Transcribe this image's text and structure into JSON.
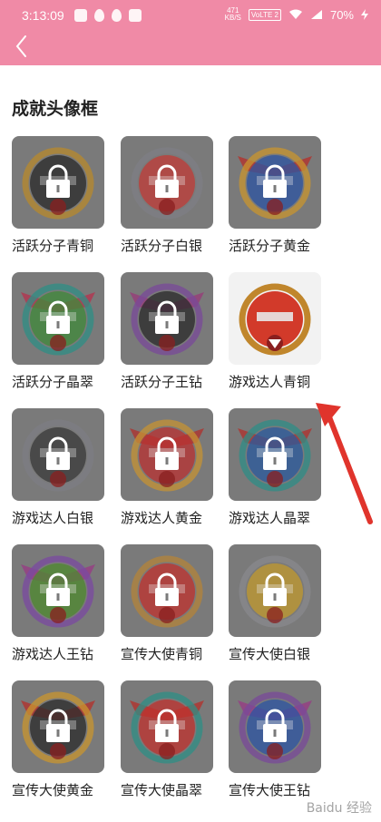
{
  "status_bar": {
    "time": "3:13:09",
    "speed_top": "471",
    "speed_bottom": "KB/S",
    "network_badge": "VoLTE 2",
    "battery": "70%"
  },
  "header": {
    "back_icon": "chevron-left-icon"
  },
  "section": {
    "title": "成就头像框"
  },
  "frames": [
    {
      "label": "活跃分子青铜",
      "ring": "#b88a2c",
      "face": "#2a2a2a",
      "wing": null,
      "locked": true
    },
    {
      "label": "活跃分子白银",
      "ring": "#7f7f86",
      "face": "#c23b37",
      "wing": null,
      "locked": true
    },
    {
      "label": "活跃分子黄金",
      "ring": "#c9962f",
      "face": "#2c54a3",
      "wing": "#b72f2a",
      "locked": true
    },
    {
      "label": "活跃分子晶翠",
      "ring": "#2f8f86",
      "face": "#3f8a3a",
      "wing": "#b7324d",
      "locked": true
    },
    {
      "label": "活跃分子王钻",
      "ring": "#7a4a9a",
      "face": "#2a2a2a",
      "wing": "#9a3a7a",
      "locked": true
    },
    {
      "label": "游戏达人青铜",
      "ring": "#c0862c",
      "face": "#d23a2a",
      "wing": null,
      "locked": false
    },
    {
      "label": "游戏达人白银",
      "ring": "#7e7e84",
      "face": "#3a3a3a",
      "wing": null,
      "locked": true
    },
    {
      "label": "游戏达人黄金",
      "ring": "#c59334",
      "face": "#b93131",
      "wing": "#b1302c",
      "locked": true
    },
    {
      "label": "游戏达人晶翠",
      "ring": "#2f8e87",
      "face": "#2a5a9e",
      "wing": "#b1302c",
      "locked": true
    },
    {
      "label": "游戏达人王钻",
      "ring": "#7b4aa2",
      "face": "#4e8a2e",
      "wing": "#9a3a86",
      "locked": true
    },
    {
      "label": "宣传大使青铜",
      "ring": "#b4843a",
      "face": "#c0322e",
      "wing": null,
      "locked": true
    },
    {
      "label": "宣传大使白银",
      "ring": "#8a8a8e",
      "face": "#c29a2e",
      "wing": null,
      "locked": true
    },
    {
      "label": "宣传大使黄金",
      "ring": "#c9962f",
      "face": "#2b2b2b",
      "wing": "#b52f2a",
      "locked": true
    },
    {
      "label": "宣传大使晶翠",
      "ring": "#2f8f86",
      "face": "#c0322e",
      "wing": "#b52f2a",
      "locked": true
    },
    {
      "label": "宣传大使王钻",
      "ring": "#7a4a9a",
      "face": "#2c54a3",
      "wing": "#9a3a86",
      "locked": true
    }
  ],
  "watermark": "Baidu 经验"
}
